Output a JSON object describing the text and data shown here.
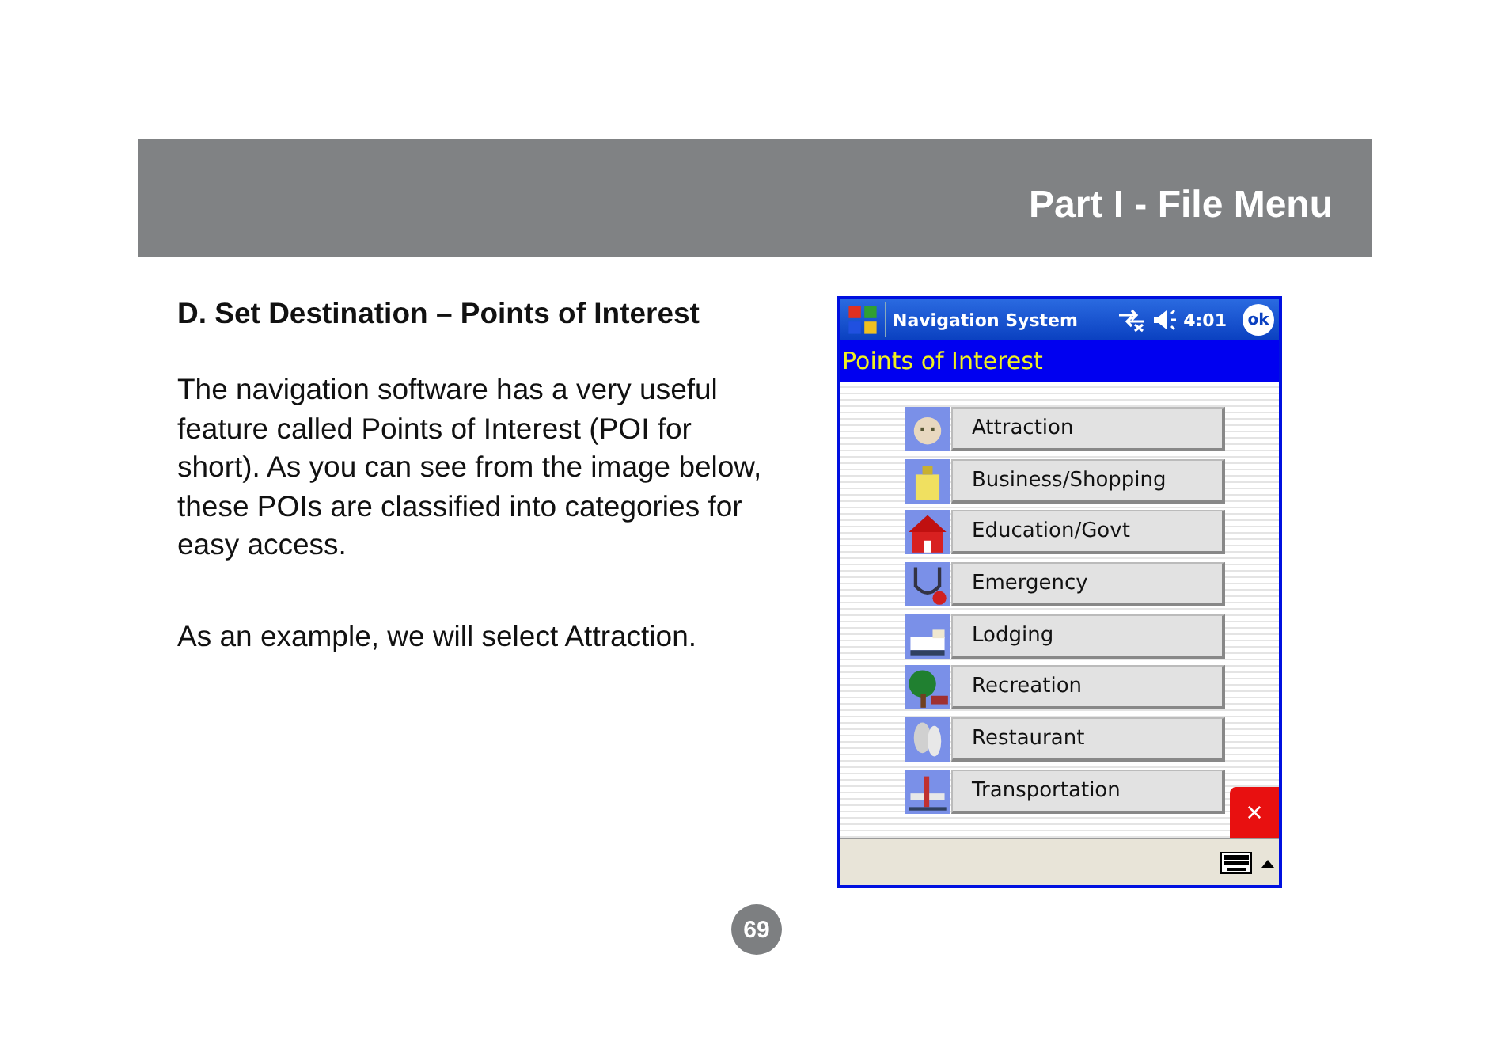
{
  "header": {
    "title": "Part I - File Menu"
  },
  "section": {
    "heading": "D. Set Destination – Points of Interest",
    "paragraphs": [
      "The navigation software has a very useful feature called Points of Interest (POI for short).  As you can see from the image below, these POIs are classified into categories for easy access.",
      "As an example, we will select Attraction."
    ]
  },
  "device": {
    "title_bar": {
      "title": "Navigation System",
      "time": "4:01",
      "ok": "ok"
    },
    "screen_title": "Points of Interest",
    "categories": [
      {
        "label": "Attraction"
      },
      {
        "label": "Business/Shopping"
      },
      {
        "label": "Education/Govt"
      },
      {
        "label": "Emergency"
      },
      {
        "label": "Lodging"
      },
      {
        "label": "Recreation"
      },
      {
        "label": "Restaurant"
      },
      {
        "label": "Transportation"
      }
    ],
    "close": "×"
  },
  "page_number": "69"
}
